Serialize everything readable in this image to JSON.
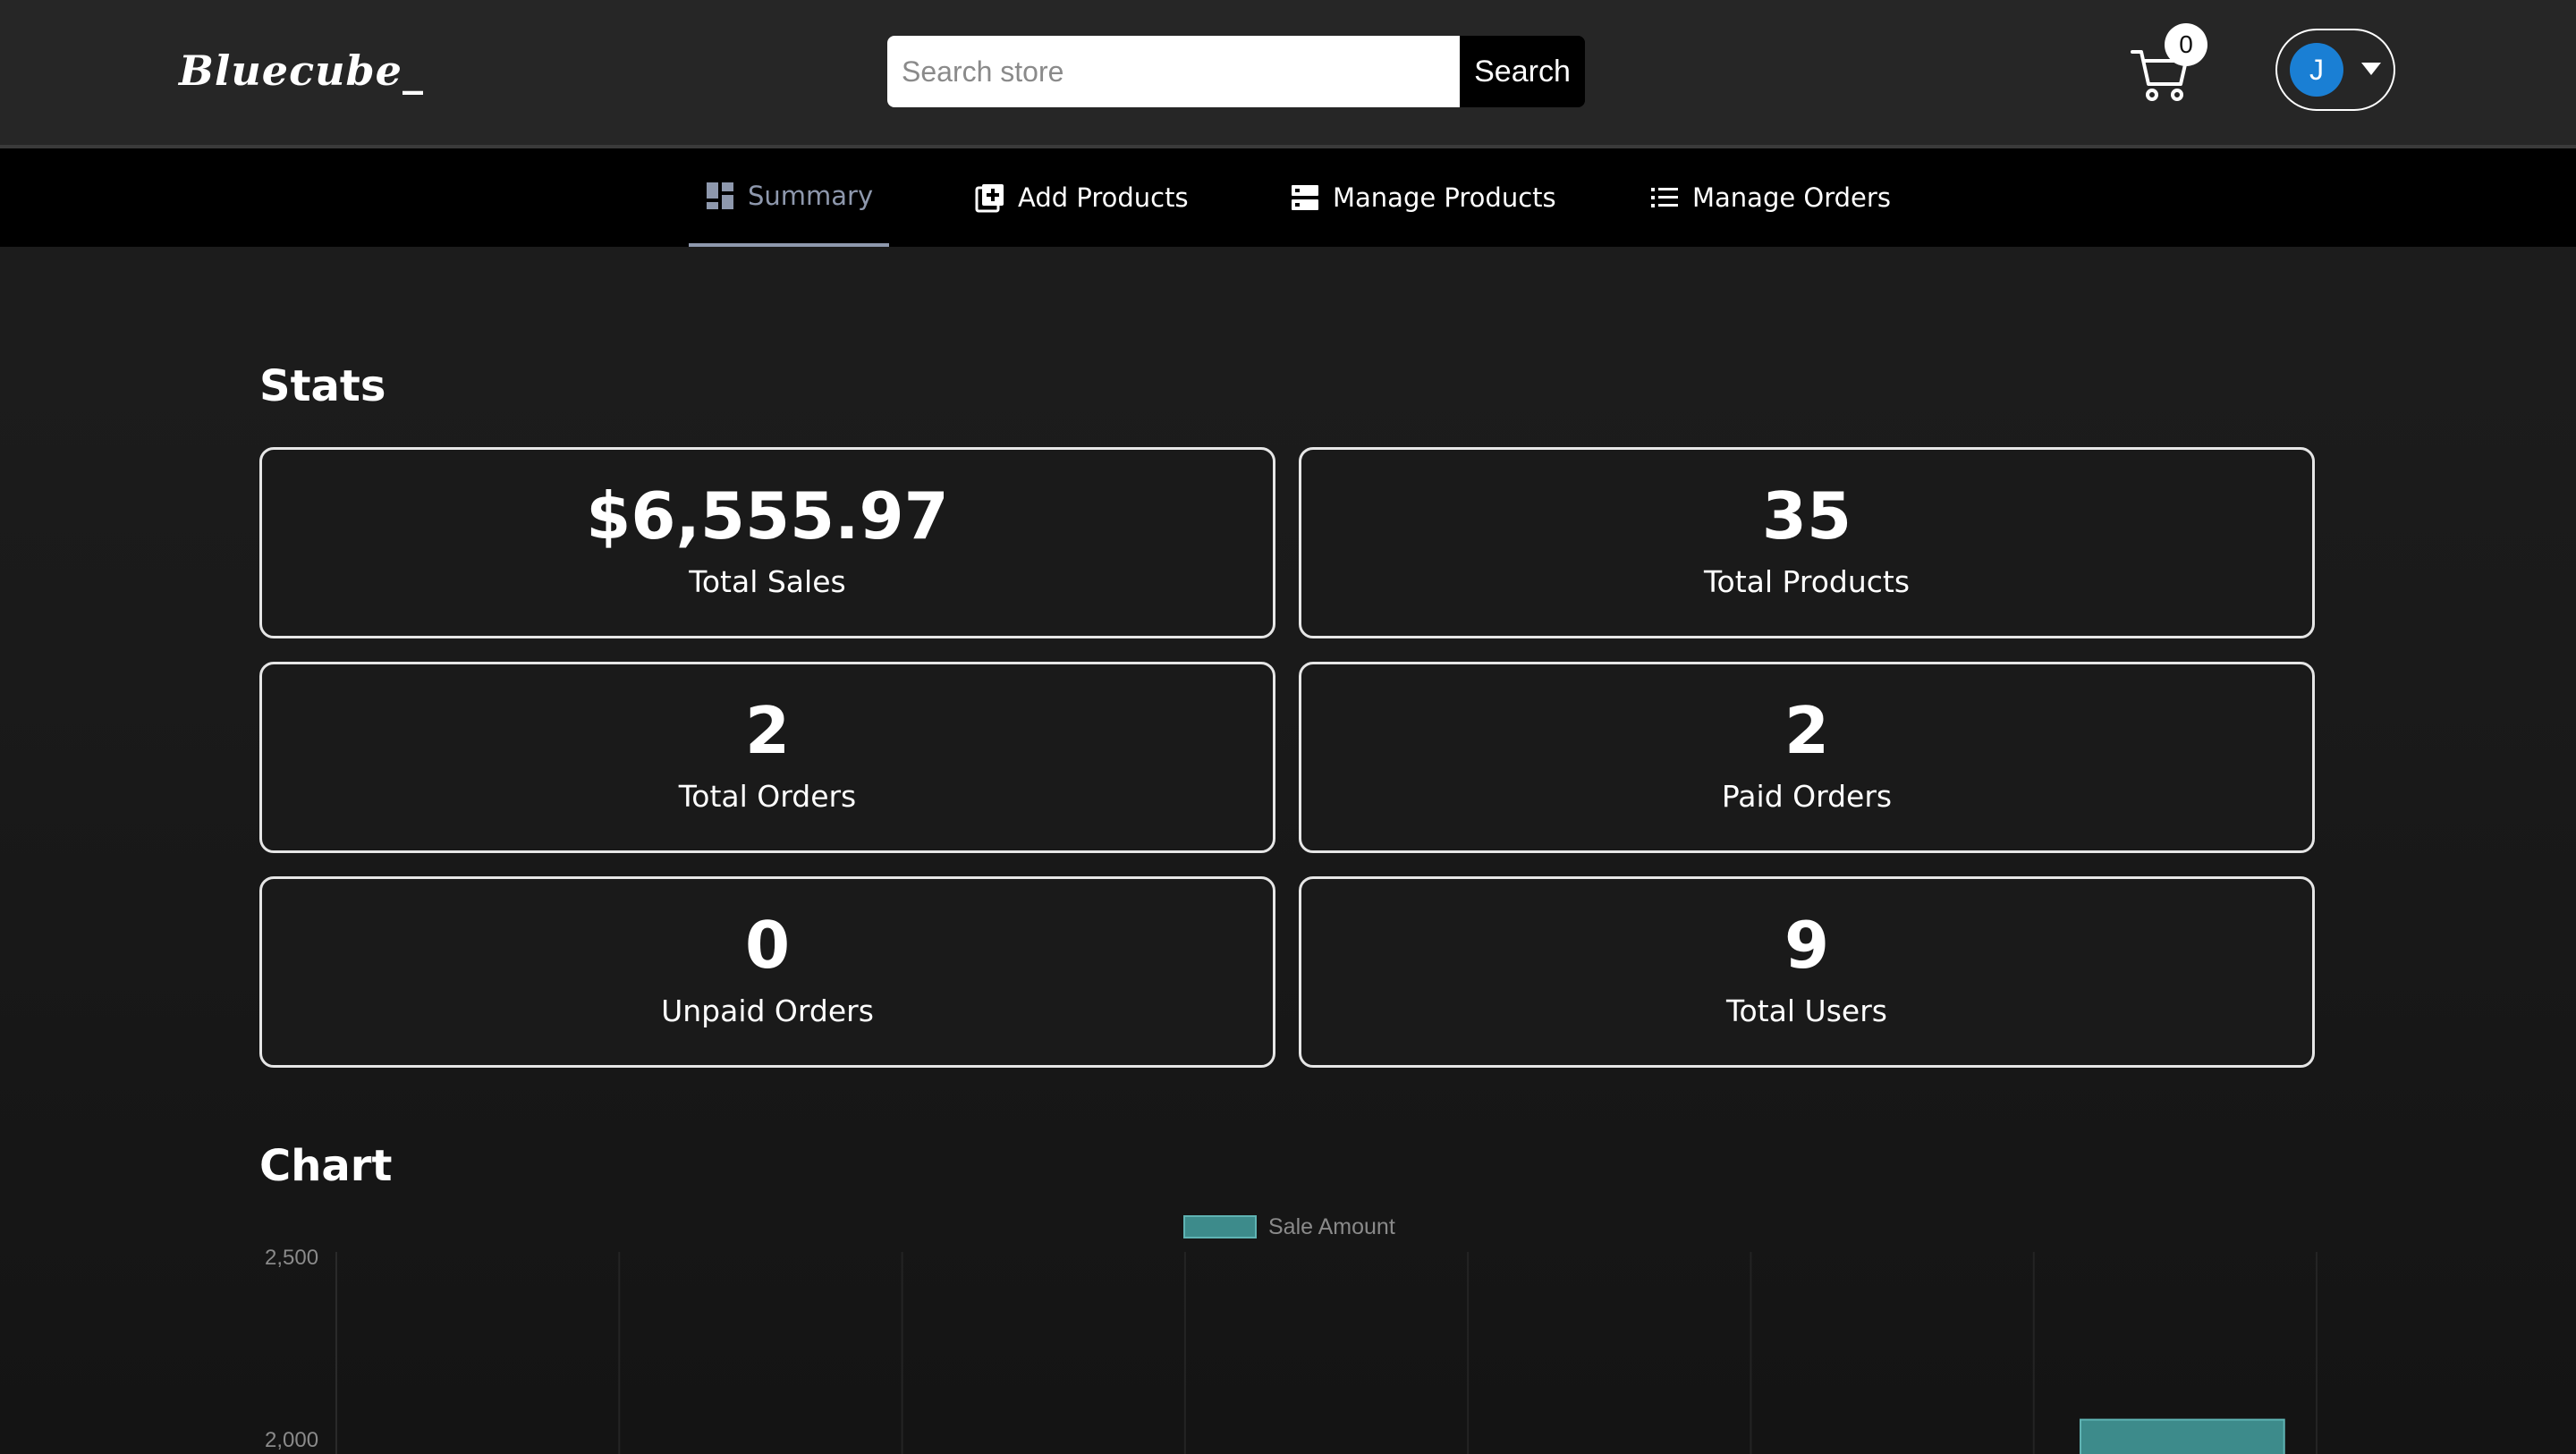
{
  "header": {
    "logo": "Bluecube_",
    "search_placeholder": "Search store",
    "search_button": "Search",
    "cart_count": "0",
    "avatar_initial": "J",
    "icons": [
      "cart-icon",
      "caret-down-icon"
    ]
  },
  "nav": {
    "items": [
      {
        "label": "Summary",
        "icon": "dashboard-icon",
        "active": true
      },
      {
        "label": "Add Products",
        "icon": "add-box-icon",
        "active": false
      },
      {
        "label": "Manage Products",
        "icon": "storage-icon",
        "active": false
      },
      {
        "label": "Manage Orders",
        "icon": "list-icon",
        "active": false
      }
    ]
  },
  "stats": {
    "title": "Stats",
    "cards": [
      {
        "value": "$6,555.97",
        "label": "Total Sales"
      },
      {
        "value": "35",
        "label": "Total Products"
      },
      {
        "value": "2",
        "label": "Total Orders"
      },
      {
        "value": "2",
        "label": "Paid Orders"
      },
      {
        "value": "0",
        "label": "Unpaid Orders"
      },
      {
        "value": "9",
        "label": "Total Users"
      }
    ]
  },
  "chart_section": {
    "title": "Chart"
  },
  "chart_data": {
    "type": "bar",
    "legend": "Sale Amount",
    "legend_position": "top-center",
    "series": [
      {
        "name": "Sale Amount",
        "color": "#3d8b8b"
      }
    ],
    "y_ticks": [
      "2,500",
      "2,000"
    ],
    "ylim": [
      0,
      2500
    ],
    "visible_bars": [
      {
        "position": "last",
        "value": 2050
      }
    ],
    "grid": true
  },
  "colors": {
    "accent_active_nav": "#8e98ad",
    "avatar": "#1a7fd4",
    "bar": "#3d8b8b"
  }
}
